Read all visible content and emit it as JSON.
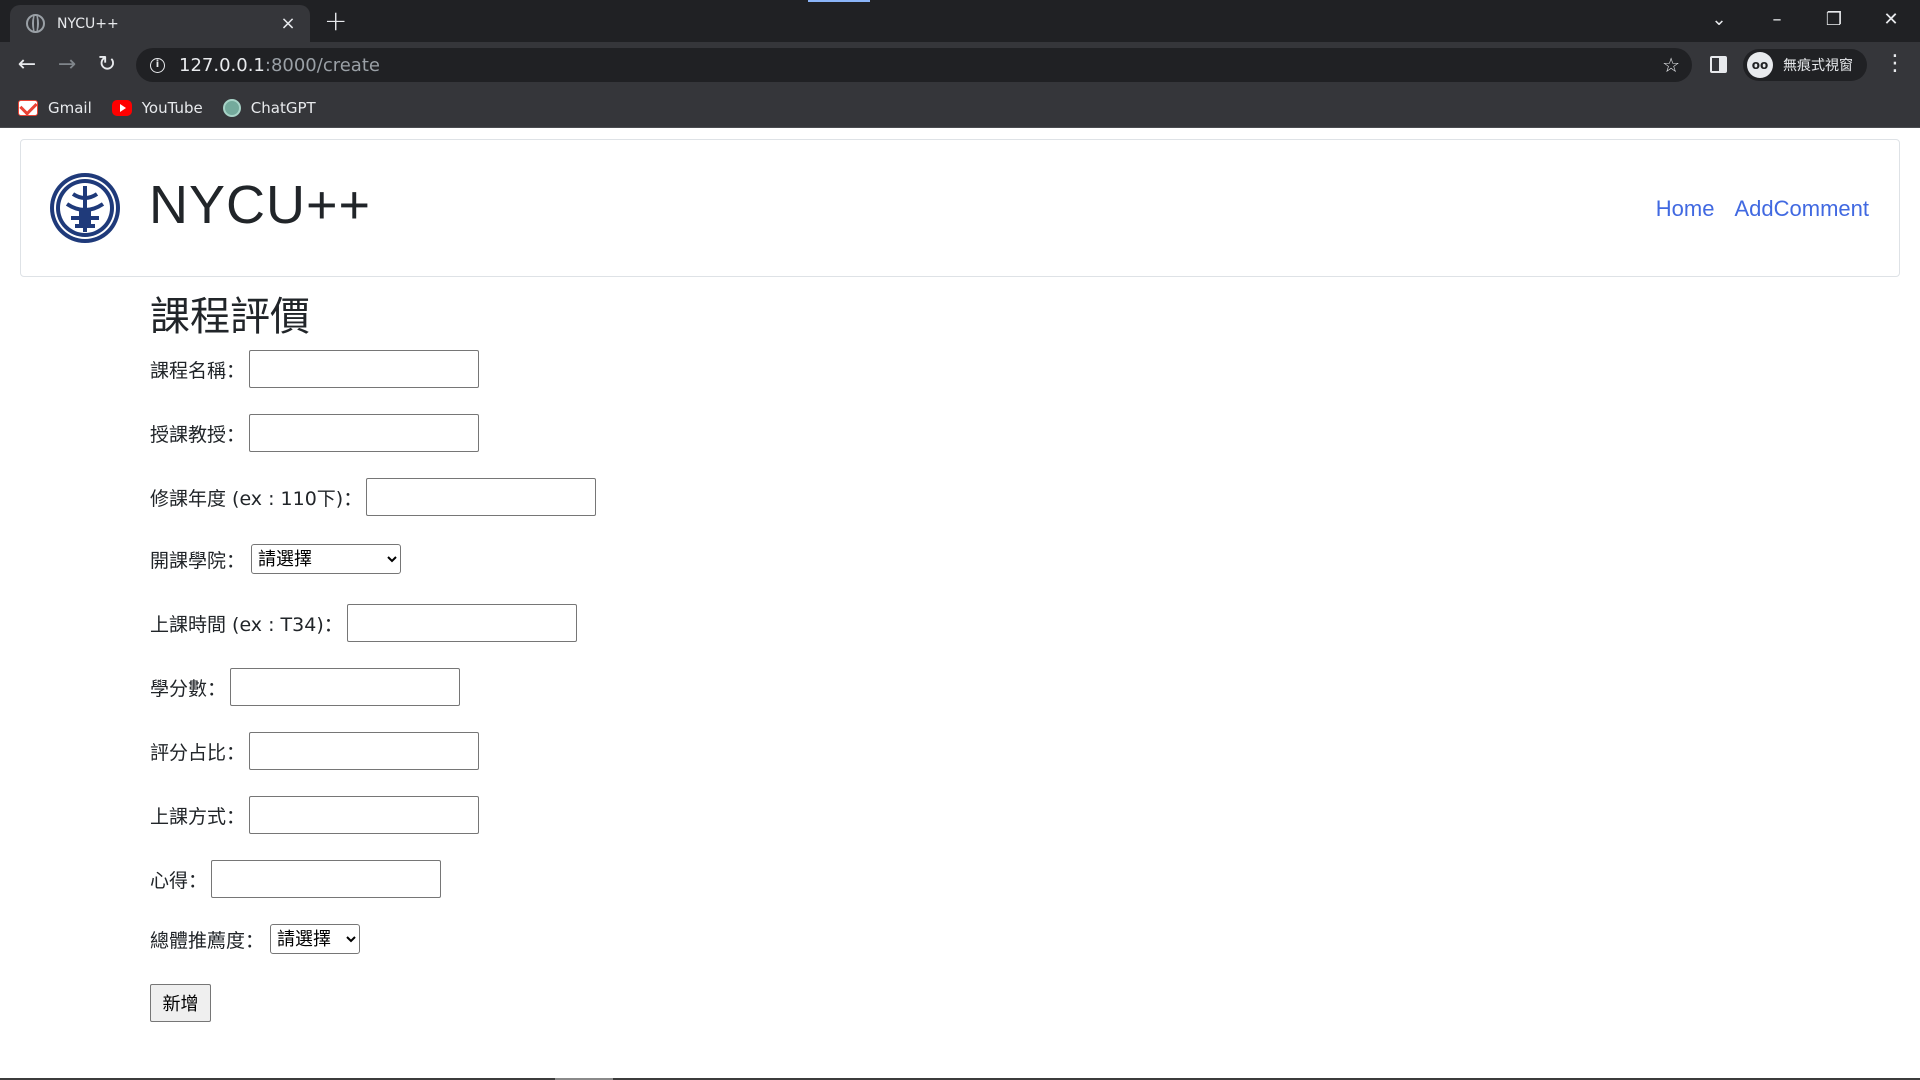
{
  "browser": {
    "tab_title": "NYCU++",
    "tab_close": "×",
    "new_tab": "+",
    "url_host": "127.0.0.1",
    "url_path": ":8000/create",
    "profile_label": "無痕式視窗",
    "bookmarks": [
      {
        "label": "Gmail",
        "icon": "gmail-icon"
      },
      {
        "label": "YouTube",
        "icon": "youtube-icon"
      },
      {
        "label": "ChatGPT",
        "icon": "chatgpt-icon"
      }
    ],
    "accent_color": "#8ab4f8",
    "chrome_dark": "#202124",
    "chrome_toolbar": "#35363a"
  },
  "navbar": {
    "brand": "NYCU++",
    "logo_icon": "nycu-seal-icon",
    "links": [
      "Home",
      "AddComment"
    ],
    "link_color": "#4169e1"
  },
  "form": {
    "heading": "課程評價",
    "fields": {
      "course_name": {
        "label": "課程名稱：",
        "value": ""
      },
      "professor": {
        "label": "授課教授：",
        "value": ""
      },
      "year": {
        "label": "修課年度 (ex : 110下)：",
        "value": ""
      },
      "college": {
        "label": "開課學院：",
        "selected": "請選擇"
      },
      "time": {
        "label": "上課時間 (ex : T34)：",
        "value": ""
      },
      "credits": {
        "label": "學分數：",
        "value": ""
      },
      "grading": {
        "label": "評分占比：",
        "value": ""
      },
      "method": {
        "label": "上課方式：",
        "value": ""
      },
      "review": {
        "label": "心得：",
        "value": ""
      },
      "recommend": {
        "label": "總體推薦度：",
        "selected": "請選擇"
      }
    },
    "submit_label": "新增"
  }
}
